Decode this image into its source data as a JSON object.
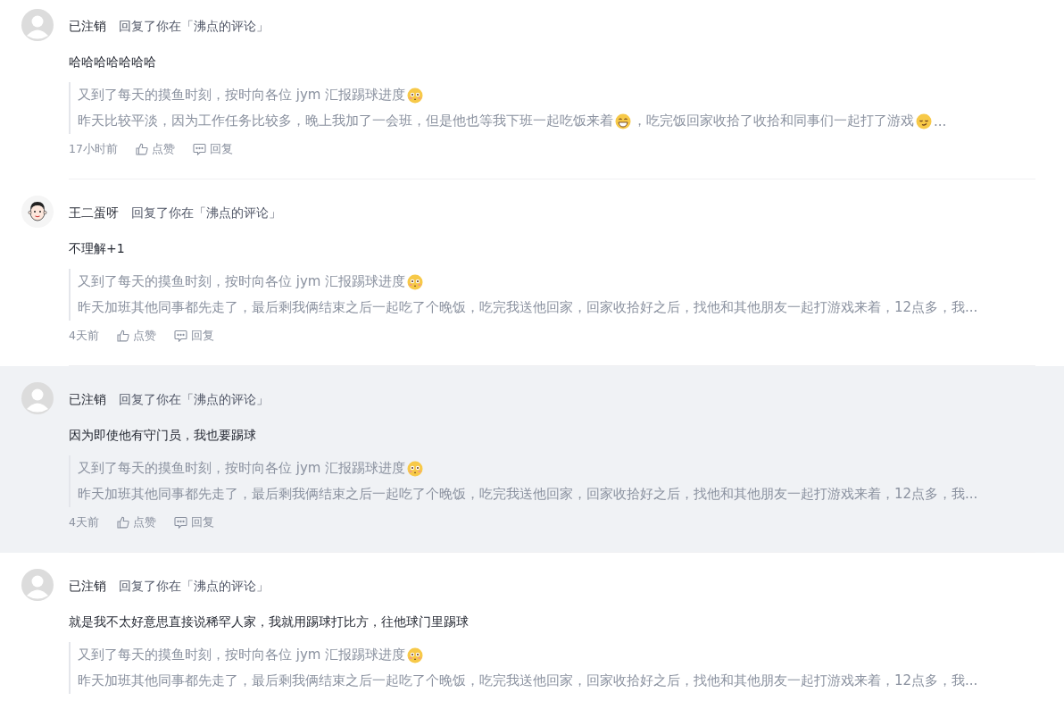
{
  "comments": [
    {
      "user": "已注销",
      "avatar": {
        "kind": "default"
      },
      "action": "回复了你在「沸点的评论」",
      "highlighted": false,
      "text": "哈哈哈哈哈哈哈",
      "quote": [
        [
          {
            "kind": "text",
            "text": "又到了每天的摸鱼时刻，按时向各位 jym 汇报踢球进度"
          },
          {
            "kind": "blush"
          }
        ],
        [
          {
            "kind": "text",
            "text": "昨天比较平淡，因为工作任务比较多，晚上我加了一会班，但是他也等我下班一起吃饭来着"
          },
          {
            "kind": "grin"
          },
          {
            "kind": "text",
            "text": "，吃完饭回家收拾了收拾和同事们一起打了游戏"
          },
          {
            "kind": "smirk"
          },
          {
            "kind": "text",
            "text": "..."
          }
        ]
      ],
      "time": "17小时前",
      "like": "点赞",
      "reply": "回复"
    },
    {
      "user": "王二蛋呀",
      "avatar": {
        "kind": "cartoon"
      },
      "action": "回复了你在「沸点的评论」",
      "highlighted": false,
      "text": "不理解+1",
      "quote": [
        [
          {
            "kind": "text",
            "text": "又到了每天的摸鱼时刻，按时向各位 jym 汇报踢球进度"
          },
          {
            "kind": "blush"
          }
        ],
        [
          {
            "kind": "text",
            "text": "昨天加班其他同事都先走了，最后剩我俩结束之后一起吃了个晚饭，吃完我送他回家，回家收拾好之后，找他和其他朋友一起打游戏来着，12点多，我..."
          }
        ]
      ],
      "time": "4天前",
      "like": "点赞",
      "reply": "回复"
    },
    {
      "user": "已注销",
      "avatar": {
        "kind": "default"
      },
      "action": "回复了你在「沸点的评论」",
      "highlighted": true,
      "text": "因为即使他有守门员，我也要踢球",
      "quote": [
        [
          {
            "kind": "text",
            "text": "又到了每天的摸鱼时刻，按时向各位 jym 汇报踢球进度"
          },
          {
            "kind": "blush"
          }
        ],
        [
          {
            "kind": "text",
            "text": "昨天加班其他同事都先走了，最后剩我俩结束之后一起吃了个晚饭，吃完我送他回家，回家收拾好之后，找他和其他朋友一起打游戏来着，12点多，我..."
          }
        ]
      ],
      "time": "4天前",
      "like": "点赞",
      "reply": "回复"
    },
    {
      "user": "已注销",
      "avatar": {
        "kind": "default"
      },
      "action": "回复了你在「沸点的评论」",
      "highlighted": false,
      "text": "就是我不太好意思直接说稀罕人家，我就用踢球打比方，往他球门里踢球",
      "quote": [
        [
          {
            "kind": "text",
            "text": "又到了每天的摸鱼时刻，按时向各位 jym 汇报踢球进度"
          },
          {
            "kind": "blush"
          }
        ],
        [
          {
            "kind": "text",
            "text": "昨天加班其他同事都先走了，最后剩我俩结束之后一起吃了个晚饭，吃完我送他回家，回家收拾好之后，找他和其他朋友一起打游戏来着，12点多，我..."
          }
        ]
      ]
    }
  ]
}
